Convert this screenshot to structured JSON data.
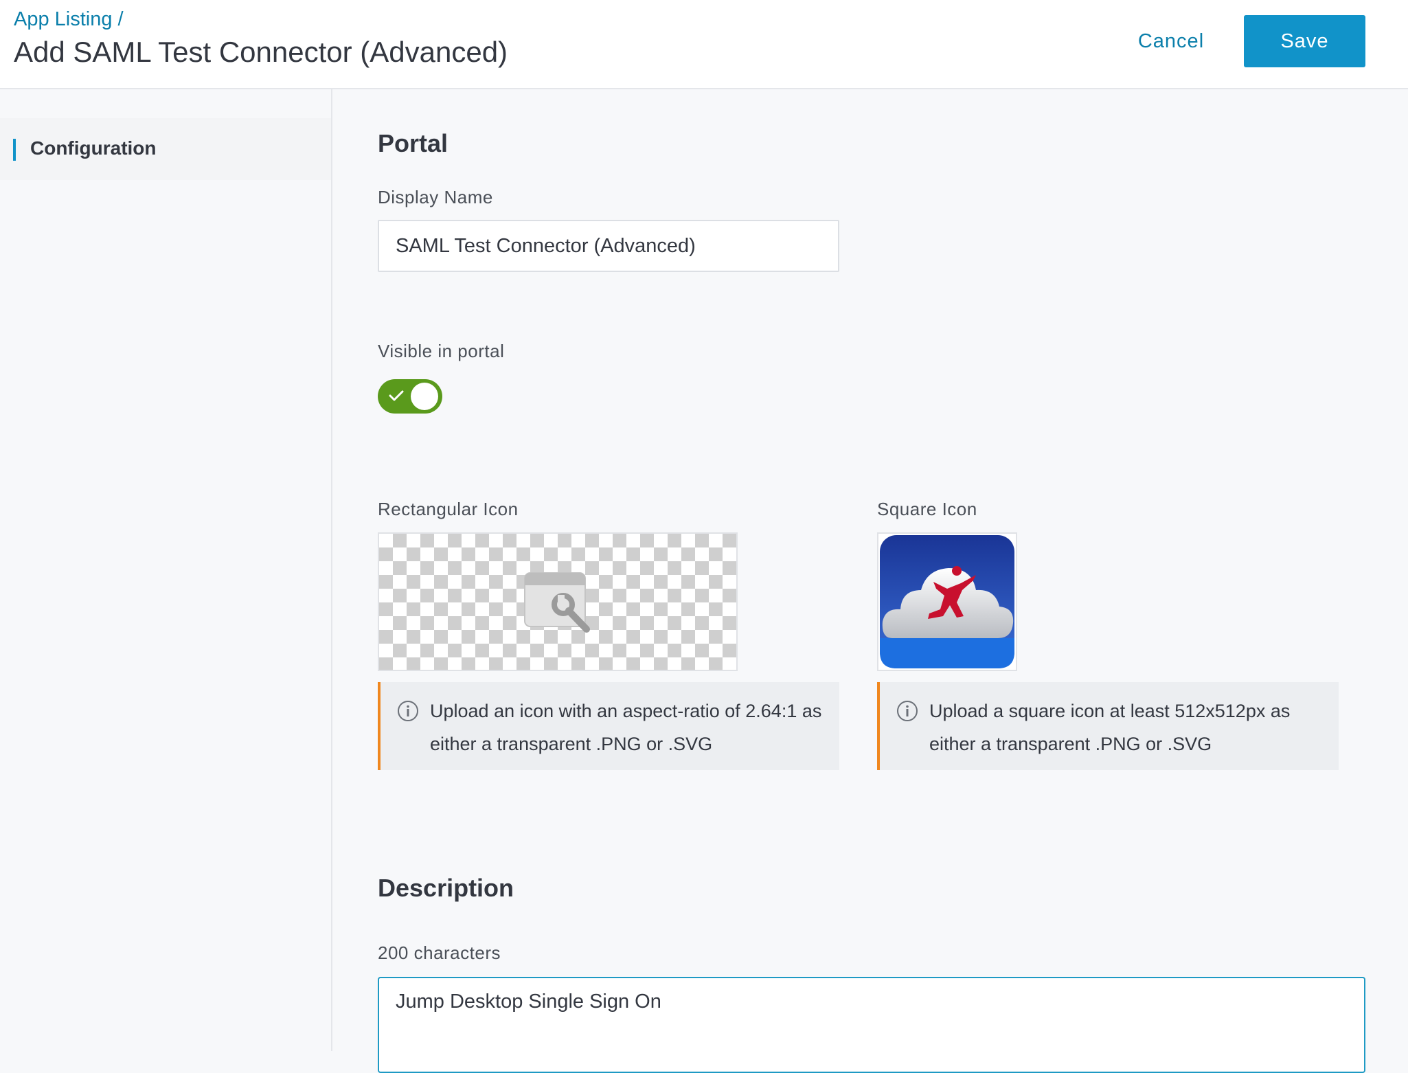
{
  "header": {
    "breadcrumb": "App Listing",
    "breadcrumb_sep": "/",
    "title": "Add SAML Test Connector (Advanced)",
    "cancel_label": "Cancel",
    "save_label": "Save"
  },
  "sidebar": {
    "items": [
      {
        "label": "Configuration",
        "active": true
      }
    ]
  },
  "portal": {
    "section_title": "Portal",
    "display_name_label": "Display Name",
    "display_name_value": "SAML Test Connector (Advanced)",
    "visible_label": "Visible in portal",
    "visible_on": true,
    "rect_icon_label": "Rectangular Icon",
    "square_icon_label": "Square Icon",
    "rect_icon_hint": "Upload an icon with an aspect-ratio of 2.64:1 as either a transparent .PNG or .SVG",
    "square_icon_hint": "Upload a square icon at least 512x512px as either a transparent .PNG or .SVG"
  },
  "description": {
    "section_title": "Description",
    "limit_label": "200 characters",
    "value": "Jump Desktop Single Sign On"
  },
  "colors": {
    "accent": "#1193c9",
    "link": "#0b7fab",
    "toggle_on": "#5a9a1c",
    "hint_border": "#f0871e"
  },
  "icons": {
    "rect_placeholder": "browser-wrench-icon",
    "square": "jump-desktop-cloud-logo",
    "info": "info-icon",
    "check": "check-icon"
  }
}
